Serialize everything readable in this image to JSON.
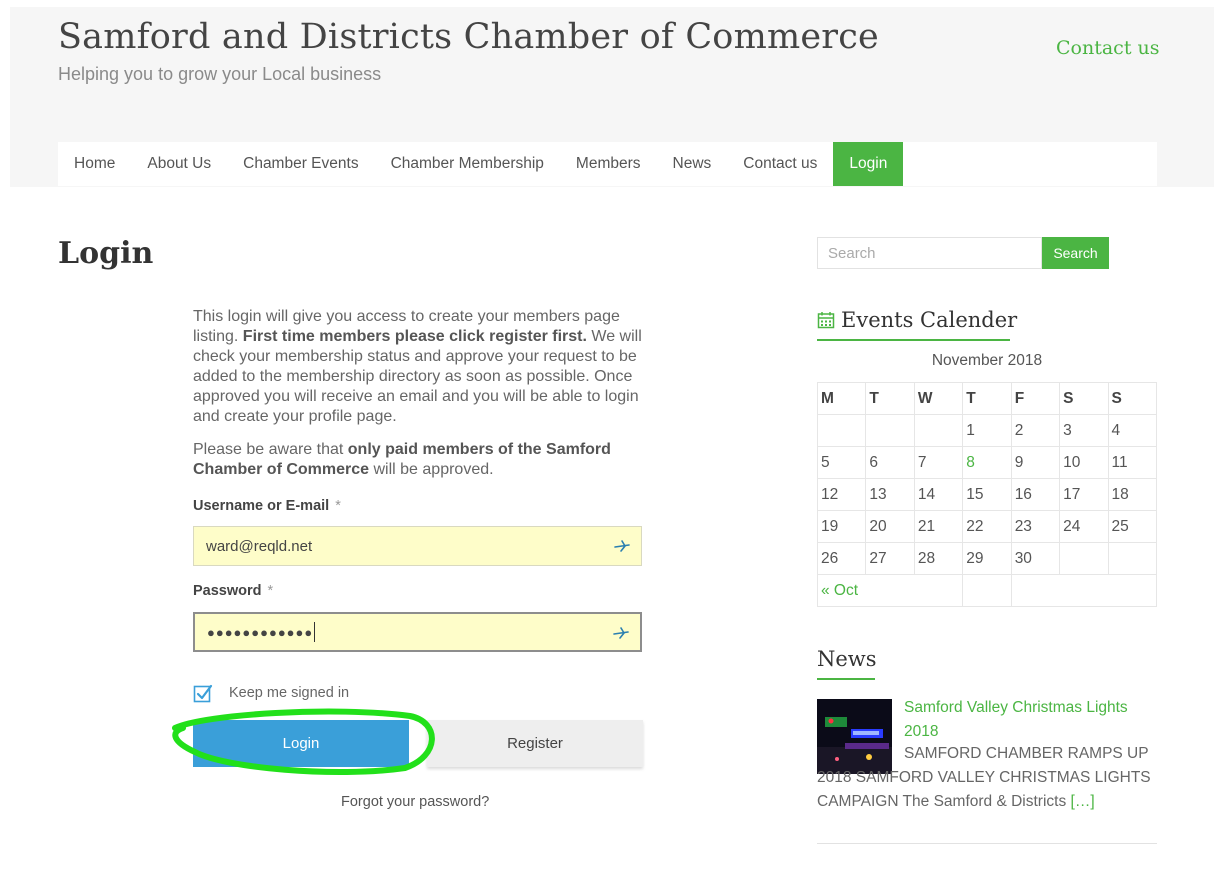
{
  "site": {
    "title": "Samford and Districts Chamber of Commerce",
    "tagline": "Helping you to grow your Local business",
    "contact_link": "Contact us"
  },
  "nav": {
    "items": [
      {
        "label": "Home"
      },
      {
        "label": "About Us"
      },
      {
        "label": "Chamber Events"
      },
      {
        "label": "Chamber Membership"
      },
      {
        "label": "Members"
      },
      {
        "label": "News"
      },
      {
        "label": "Contact us"
      },
      {
        "label": "Login",
        "active": true
      }
    ]
  },
  "page": {
    "title": "Login",
    "intro_p1_a": "This login will give you access to create your members page listing. ",
    "intro_p1_b": "First time members please click register first.",
    "intro_p1_c": " We will check your membership status and approve your request to be added to the membership directory as soon as possible. Once approved you will receive an email and you will be able to login and create your profile page.",
    "intro_p2_a": "Please be aware that ",
    "intro_p2_b": "only paid members of the Samford Chamber of Commerce",
    "intro_p2_c": " will be approved."
  },
  "form": {
    "username_label": "Username or E-mail",
    "username_value": "ward@reqld.net",
    "password_label": "Password",
    "password_mask": "●●●●●●●●●●●●",
    "required_mark": "*",
    "keep_signed_in": "Keep me signed in",
    "keep_signed_in_checked": true,
    "login_button": "Login",
    "register_button": "Register",
    "forgot_link": "Forgot your password?",
    "annotation_color": "#22e01a"
  },
  "sidebar": {
    "search_placeholder": "Search",
    "search_button": "Search",
    "calendar": {
      "title": "Events Calender",
      "caption": "November 2018",
      "weekdays": [
        "M",
        "T",
        "W",
        "T",
        "F",
        "S",
        "S"
      ],
      "weeks": [
        [
          "",
          "",
          "",
          "1",
          "2",
          "3",
          "4"
        ],
        [
          "5",
          "6",
          "7",
          "8",
          "9",
          "10",
          "11"
        ],
        [
          "12",
          "13",
          "14",
          "15",
          "16",
          "17",
          "18"
        ],
        [
          "19",
          "20",
          "21",
          "22",
          "23",
          "24",
          "25"
        ],
        [
          "26",
          "27",
          "28",
          "29",
          "30",
          "",
          ""
        ]
      ],
      "highlighted_day": "8",
      "prev_link": "« Oct"
    },
    "news": {
      "title": "News",
      "item_title": "Samford Valley Christmas Lights 2018",
      "item_excerpt": "SAMFORD CHAMBER RAMPS UP 2018 SAMFORD VALLEY CHRISTMAS LIGHTS CAMPAIGN The Samford & Districts ",
      "item_more": "[…]"
    }
  },
  "colors": {
    "accent": "#4bb543",
    "login_button": "#3a9fd9",
    "autofill": "#fefdc9",
    "header_bg": "#f6f6f6"
  }
}
